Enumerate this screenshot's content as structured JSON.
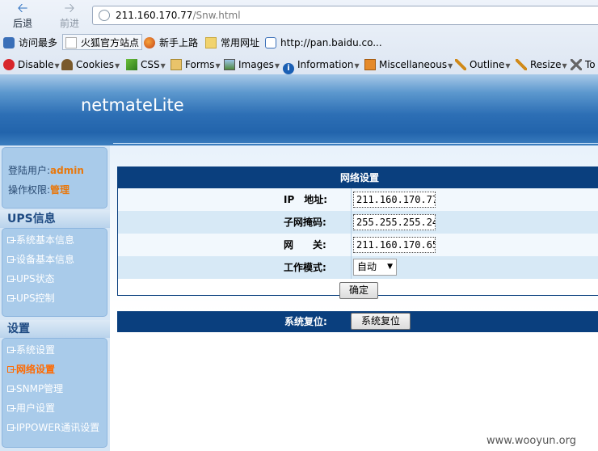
{
  "browser": {
    "back_label": "后退",
    "forward_label": "前进",
    "url_host": "211.160.170.77",
    "url_path": "/Snw.html",
    "bookmarks": [
      {
        "label": "访问最多",
        "icon": "most-visited-icon"
      },
      {
        "label": "火狐官方站点",
        "icon": "page-icon"
      },
      {
        "label": "新手上路",
        "icon": "firefox-icon"
      },
      {
        "label": "常用网址",
        "icon": "folder-icon"
      },
      {
        "label": "http://pan.baidu.co...",
        "icon": "baidu-icon"
      }
    ],
    "devtools": [
      {
        "label": "Disable",
        "icon": "disable-icon"
      },
      {
        "label": "Cookies",
        "icon": "cookies-icon"
      },
      {
        "label": "CSS",
        "icon": "css-icon"
      },
      {
        "label": "Forms",
        "icon": "forms-icon"
      },
      {
        "label": "Images",
        "icon": "images-icon"
      },
      {
        "label": "Information",
        "icon": "info-icon"
      },
      {
        "label": "Miscellaneous",
        "icon": "misc-icon"
      },
      {
        "label": "Outline",
        "icon": "outline-icon"
      },
      {
        "label": "Resize",
        "icon": "resize-icon"
      },
      {
        "label": "To",
        "icon": "tools-icon"
      }
    ]
  },
  "app": {
    "title": "netmateLite"
  },
  "sidebar": {
    "user_prefix": "登陆用户:",
    "user_name": "admin",
    "perm_prefix": "操作权限:",
    "perm_value": "管理",
    "sections": [
      {
        "title": "UPS信息",
        "items": [
          {
            "label": "系统基本信息",
            "active": false
          },
          {
            "label": "设备基本信息",
            "active": false
          },
          {
            "label": "UPS状态",
            "active": false
          },
          {
            "label": "UPS控制",
            "active": false
          }
        ]
      },
      {
        "title": "设置",
        "items": [
          {
            "label": "系统设置",
            "active": false
          },
          {
            "label": "网络设置",
            "active": true
          },
          {
            "label": "SNMP管理",
            "active": false
          },
          {
            "label": "用户设置",
            "active": false
          },
          {
            "label": "IPPOWER通讯设置",
            "active": false
          }
        ]
      }
    ]
  },
  "network": {
    "title": "网络设置",
    "ip_label": "IP　地址:",
    "ip_value": "211.160.170.77",
    "mask_label": "子网掩码:",
    "mask_value": "255.255.255.24",
    "gateway_label": "网　　关:",
    "gateway_value": "211.160.170.65",
    "mode_label": "工作模式:",
    "mode_value": "自动",
    "ok_label": "确定"
  },
  "reset": {
    "label": "系统复位:",
    "button_label": "系统复位"
  },
  "watermark": "www.wooyun.org",
  "colors": {
    "header_navy": "#0a3f7e",
    "accent_orange": "#e8780d"
  }
}
